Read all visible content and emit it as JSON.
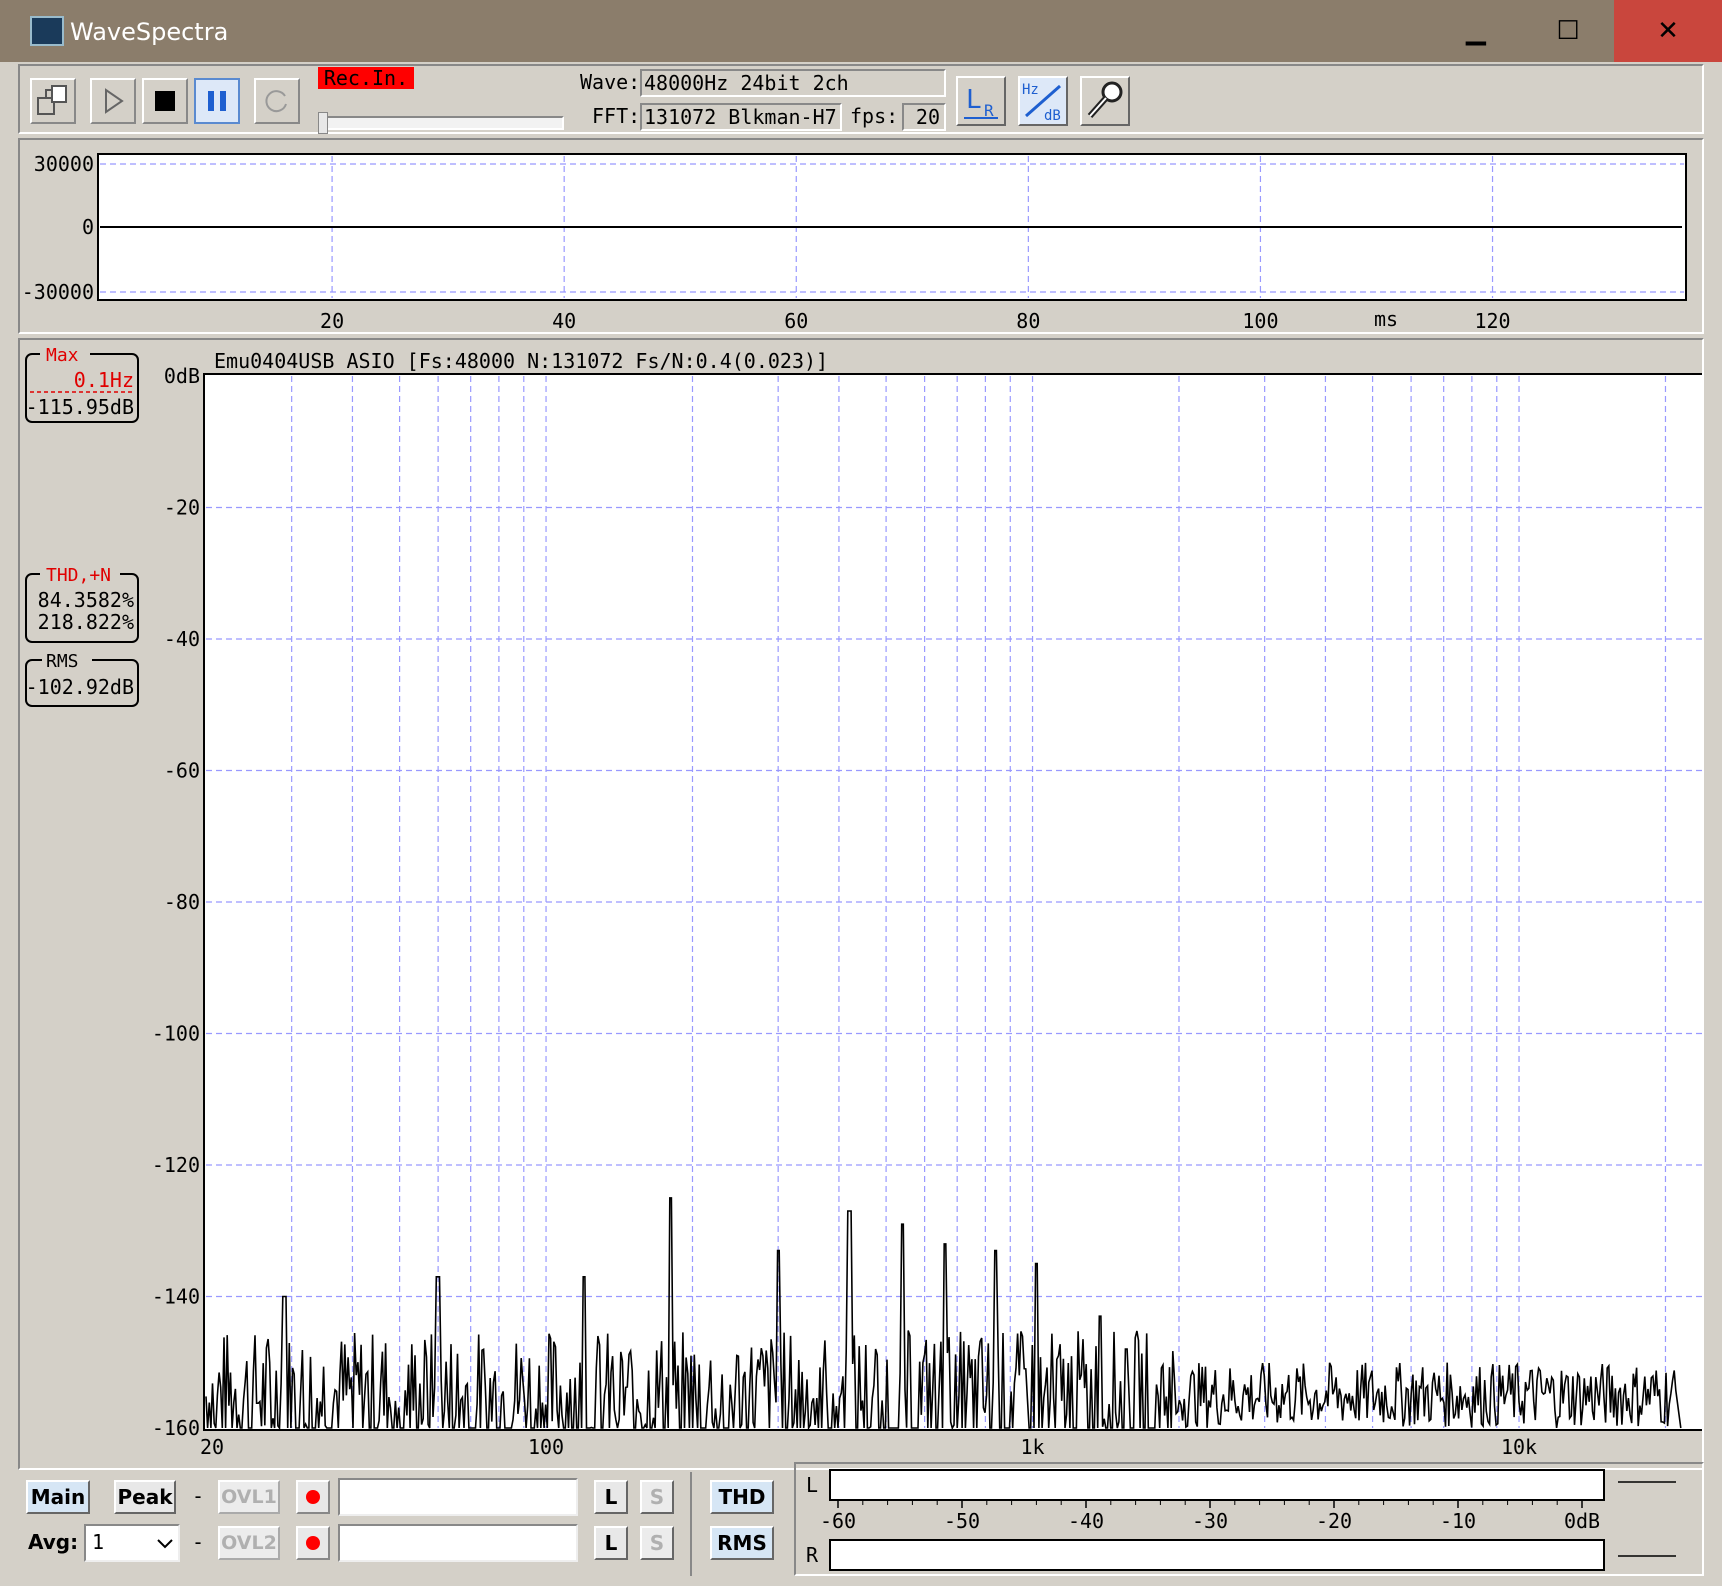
{
  "window": {
    "title": "WaveSpectra",
    "min_glyph": "▁",
    "max_glyph": "☐",
    "close_glyph": "✕"
  },
  "toolbar": {
    "rec_in_label": "Rec.In.",
    "rec_level": 0,
    "wave_label": "Wave:",
    "wave_value": "48000Hz 24bit 2ch",
    "fft_label": "FFT:",
    "fft_value": "131072 Blkman-H7",
    "fps_label": "fps:",
    "fps_value": "20",
    "lr_icon_text": [
      "L",
      "R"
    ],
    "hzdb_icon_text": [
      "Hz",
      "dB"
    ]
  },
  "waveform": {
    "y_ticks": [
      "30000",
      "0",
      "-30000"
    ],
    "x_ticks": [
      {
        "ms": 20,
        "label": "20"
      },
      {
        "ms": 40,
        "label": "40"
      },
      {
        "ms": 60,
        "label": "60"
      },
      {
        "ms": 80,
        "label": "80"
      },
      {
        "ms": 100,
        "label": "100"
      },
      {
        "ms": 120,
        "label": "120"
      }
    ],
    "x_unit": "ms",
    "x_range_ms": [
      0,
      136.5
    ]
  },
  "spectrum": {
    "header": "Emu0404USB ASIO  [Fs:48000 N:131072 Fs/N:0.4(0.023)]",
    "y_ticks": [
      "0dB",
      "-20",
      "-40",
      "-60",
      "-80",
      "-100",
      "-120",
      "-140",
      "-160"
    ],
    "x_ticks": [
      {
        "hz": 20,
        "label": "20"
      },
      {
        "hz": 100,
        "label": "100"
      },
      {
        "hz": 1000,
        "label": "1k"
      },
      {
        "hz": 10000,
        "label": "10k"
      }
    ],
    "x_range_hz": [
      20,
      24000
    ],
    "y_range_db": [
      -160,
      0
    ],
    "max_box": {
      "title": "Max",
      "freq": "0.1Hz",
      "level": "-115.95dB"
    },
    "thd_box": {
      "title": "THD,+N",
      "value1": "84.3582%",
      "value2": "218.822%"
    },
    "rms_box": {
      "title": "RMS",
      "value": "-102.92dB"
    }
  },
  "chart_data": {
    "type": "line",
    "xscale": "log",
    "xlabel": "",
    "ylabel": "",
    "xlim": [
      20,
      24000
    ],
    "ylim": [
      -160,
      0
    ],
    "peaks": [
      {
        "x": 29,
        "y": -140
      },
      {
        "x": 60,
        "y": -137
      },
      {
        "x": 120,
        "y": -137
      },
      {
        "x": 180,
        "y": -125
      },
      {
        "x": 300,
        "y": -133
      },
      {
        "x": 420,
        "y": -127
      },
      {
        "x": 540,
        "y": -129
      },
      {
        "x": 660,
        "y": -132
      },
      {
        "x": 840,
        "y": -133
      },
      {
        "x": 1020,
        "y": -135
      },
      {
        "x": 1380,
        "y": -143
      },
      {
        "x": 1560,
        "y": -148
      }
    ],
    "noise_floor_db": -155
  },
  "bottom": {
    "main_label": "Main",
    "peak_label": "Peak",
    "dash": "-",
    "ovl1_label": "OVL1",
    "ovl2_label": "OVL2",
    "l_label": "L",
    "s_label": "S",
    "avg_label": "Avg:",
    "avg_value": "1",
    "thd_label": "THD",
    "rms_label": "RMS"
  },
  "level_meter": {
    "l_label": "L",
    "r_label": "R",
    "ticks": [
      "-60",
      "-50",
      "-40",
      "-30",
      "-20",
      "-10",
      "0dB"
    ]
  }
}
